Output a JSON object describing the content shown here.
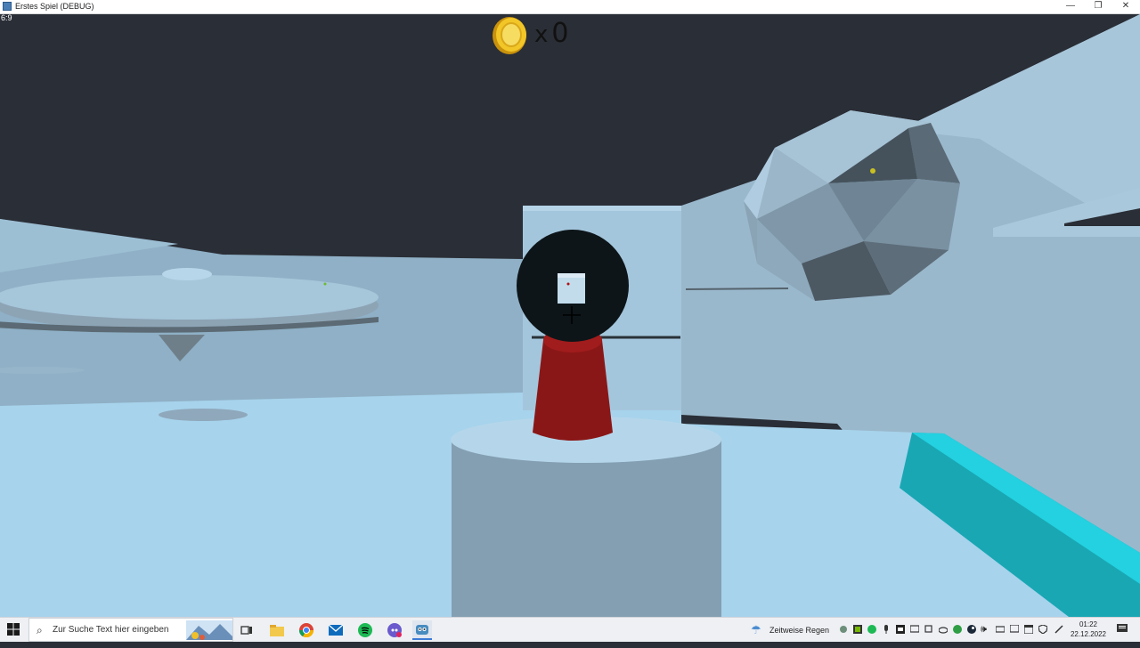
{
  "window": {
    "title": "Erstes Spiel (DEBUG)",
    "minimize": "—",
    "maximize": "❐",
    "close": "✕"
  },
  "debug": {
    "fps_label": "6:9"
  },
  "hud": {
    "coin_multiplier": "x",
    "coin_count": "0"
  },
  "taskbar": {
    "search_placeholder": "Zur Suche Text hier eingeben",
    "weather": "Zeitweise Regen",
    "time": "01:22",
    "date": "22.12.2022",
    "apps": [
      "task-view",
      "file-explorer",
      "chrome",
      "mail",
      "spotify",
      "discord",
      "godot"
    ]
  },
  "colors": {
    "sky": "#2a2e36",
    "ground": "#a7d3ec",
    "crosshair_ball": "#0d1519",
    "red_cylinder": "#8a1717",
    "cyan_beam": "#19a7b4",
    "coin": "#e8b820"
  }
}
